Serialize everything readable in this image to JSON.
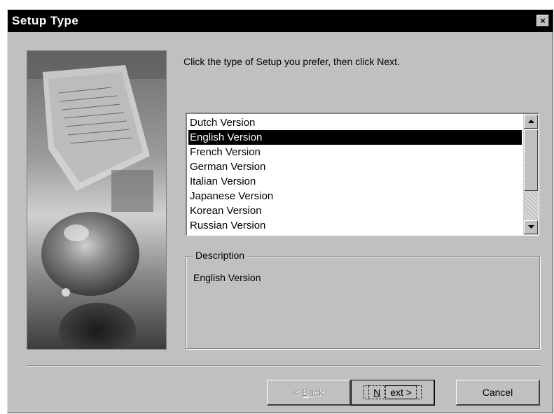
{
  "window": {
    "title": "Setup Type",
    "close_label": "×"
  },
  "instruction": "Click the type of Setup you prefer, then click Next.",
  "setup_list": {
    "items": [
      "Dutch Version",
      "English Version",
      "French Version",
      "German Version",
      "Italian Version",
      "Japanese Version",
      "Korean Version",
      "Russian Version"
    ],
    "selected_index": 1
  },
  "description": {
    "legend": "Description",
    "text": "English Version"
  },
  "buttons": {
    "back_mnemonic": "B",
    "back_rest": "ack",
    "back_prefix": "< ",
    "next_mnemonic": "N",
    "next_rest": "ext >",
    "cancel": "Cancel"
  },
  "colors": {
    "dialog_bg": "#c0c0c0",
    "titlebar_bg": "#000000",
    "selection_bg": "#000000"
  },
  "icons": {
    "close": "close-icon",
    "scroll_up": "up-arrow-icon",
    "scroll_down": "down-arrow-icon"
  }
}
